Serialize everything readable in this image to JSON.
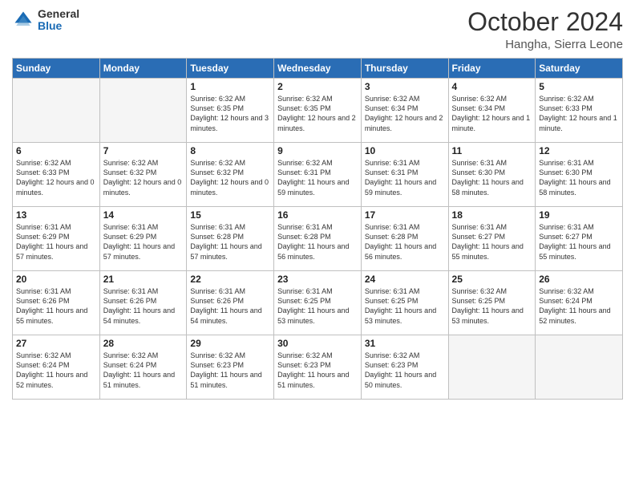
{
  "logo": {
    "general": "General",
    "blue": "Blue"
  },
  "header": {
    "month": "October 2024",
    "location": "Hangha, Sierra Leone"
  },
  "weekdays": [
    "Sunday",
    "Monday",
    "Tuesday",
    "Wednesday",
    "Thursday",
    "Friday",
    "Saturday"
  ],
  "weeks": [
    [
      {
        "day": "",
        "info": ""
      },
      {
        "day": "",
        "info": ""
      },
      {
        "day": "1",
        "info": "Sunrise: 6:32 AM\nSunset: 6:35 PM\nDaylight: 12 hours and 3 minutes."
      },
      {
        "day": "2",
        "info": "Sunrise: 6:32 AM\nSunset: 6:35 PM\nDaylight: 12 hours and 2 minutes."
      },
      {
        "day": "3",
        "info": "Sunrise: 6:32 AM\nSunset: 6:34 PM\nDaylight: 12 hours and 2 minutes."
      },
      {
        "day": "4",
        "info": "Sunrise: 6:32 AM\nSunset: 6:34 PM\nDaylight: 12 hours and 1 minute."
      },
      {
        "day": "5",
        "info": "Sunrise: 6:32 AM\nSunset: 6:33 PM\nDaylight: 12 hours and 1 minute."
      }
    ],
    [
      {
        "day": "6",
        "info": "Sunrise: 6:32 AM\nSunset: 6:33 PM\nDaylight: 12 hours and 0 minutes."
      },
      {
        "day": "7",
        "info": "Sunrise: 6:32 AM\nSunset: 6:32 PM\nDaylight: 12 hours and 0 minutes."
      },
      {
        "day": "8",
        "info": "Sunrise: 6:32 AM\nSunset: 6:32 PM\nDaylight: 12 hours and 0 minutes."
      },
      {
        "day": "9",
        "info": "Sunrise: 6:32 AM\nSunset: 6:31 PM\nDaylight: 11 hours and 59 minutes."
      },
      {
        "day": "10",
        "info": "Sunrise: 6:31 AM\nSunset: 6:31 PM\nDaylight: 11 hours and 59 minutes."
      },
      {
        "day": "11",
        "info": "Sunrise: 6:31 AM\nSunset: 6:30 PM\nDaylight: 11 hours and 58 minutes."
      },
      {
        "day": "12",
        "info": "Sunrise: 6:31 AM\nSunset: 6:30 PM\nDaylight: 11 hours and 58 minutes."
      }
    ],
    [
      {
        "day": "13",
        "info": "Sunrise: 6:31 AM\nSunset: 6:29 PM\nDaylight: 11 hours and 57 minutes."
      },
      {
        "day": "14",
        "info": "Sunrise: 6:31 AM\nSunset: 6:29 PM\nDaylight: 11 hours and 57 minutes."
      },
      {
        "day": "15",
        "info": "Sunrise: 6:31 AM\nSunset: 6:28 PM\nDaylight: 11 hours and 57 minutes."
      },
      {
        "day": "16",
        "info": "Sunrise: 6:31 AM\nSunset: 6:28 PM\nDaylight: 11 hours and 56 minutes."
      },
      {
        "day": "17",
        "info": "Sunrise: 6:31 AM\nSunset: 6:28 PM\nDaylight: 11 hours and 56 minutes."
      },
      {
        "day": "18",
        "info": "Sunrise: 6:31 AM\nSunset: 6:27 PM\nDaylight: 11 hours and 55 minutes."
      },
      {
        "day": "19",
        "info": "Sunrise: 6:31 AM\nSunset: 6:27 PM\nDaylight: 11 hours and 55 minutes."
      }
    ],
    [
      {
        "day": "20",
        "info": "Sunrise: 6:31 AM\nSunset: 6:26 PM\nDaylight: 11 hours and 55 minutes."
      },
      {
        "day": "21",
        "info": "Sunrise: 6:31 AM\nSunset: 6:26 PM\nDaylight: 11 hours and 54 minutes."
      },
      {
        "day": "22",
        "info": "Sunrise: 6:31 AM\nSunset: 6:26 PM\nDaylight: 11 hours and 54 minutes."
      },
      {
        "day": "23",
        "info": "Sunrise: 6:31 AM\nSunset: 6:25 PM\nDaylight: 11 hours and 53 minutes."
      },
      {
        "day": "24",
        "info": "Sunrise: 6:31 AM\nSunset: 6:25 PM\nDaylight: 11 hours and 53 minutes."
      },
      {
        "day": "25",
        "info": "Sunrise: 6:32 AM\nSunset: 6:25 PM\nDaylight: 11 hours and 53 minutes."
      },
      {
        "day": "26",
        "info": "Sunrise: 6:32 AM\nSunset: 6:24 PM\nDaylight: 11 hours and 52 minutes."
      }
    ],
    [
      {
        "day": "27",
        "info": "Sunrise: 6:32 AM\nSunset: 6:24 PM\nDaylight: 11 hours and 52 minutes."
      },
      {
        "day": "28",
        "info": "Sunrise: 6:32 AM\nSunset: 6:24 PM\nDaylight: 11 hours and 51 minutes."
      },
      {
        "day": "29",
        "info": "Sunrise: 6:32 AM\nSunset: 6:23 PM\nDaylight: 11 hours and 51 minutes."
      },
      {
        "day": "30",
        "info": "Sunrise: 6:32 AM\nSunset: 6:23 PM\nDaylight: 11 hours and 51 minutes."
      },
      {
        "day": "31",
        "info": "Sunrise: 6:32 AM\nSunset: 6:23 PM\nDaylight: 11 hours and 50 minutes."
      },
      {
        "day": "",
        "info": ""
      },
      {
        "day": "",
        "info": ""
      }
    ]
  ]
}
